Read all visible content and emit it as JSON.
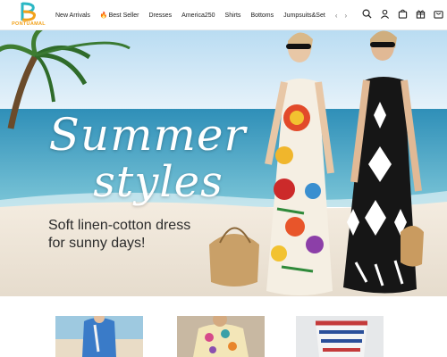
{
  "brand": {
    "logo_text": "PONTUAMAL"
  },
  "nav": {
    "items": [
      {
        "label": "New Arrivals",
        "icon": ""
      },
      {
        "label": "Best Seller",
        "icon": "fire-icon"
      },
      {
        "label": "Dresses",
        "icon": ""
      },
      {
        "label": "America250",
        "icon": ""
      },
      {
        "label": "Shirts",
        "icon": ""
      },
      {
        "label": "Bottoms",
        "icon": ""
      },
      {
        "label": "Jumpsuits&Set",
        "icon": ""
      }
    ],
    "prev_icon": "chevron-left-icon",
    "next_icon": "chevron-right-icon"
  },
  "header_icons": [
    "search-icon",
    "account-icon",
    "bag-icon",
    "gift-icon",
    "cart-icon"
  ],
  "hero": {
    "headline_line1": "Summer",
    "headline_line2": "styles",
    "subtitle_line1": "Soft linen-cotton dress",
    "subtitle_line2": "for sunny days!"
  },
  "colors": {
    "accent": "#f2a21b",
    "logo_teal": "#2bb7c4",
    "sky": "#cfe6f5",
    "sea": "#3b9fc0",
    "sand": "#efe6d8"
  }
}
